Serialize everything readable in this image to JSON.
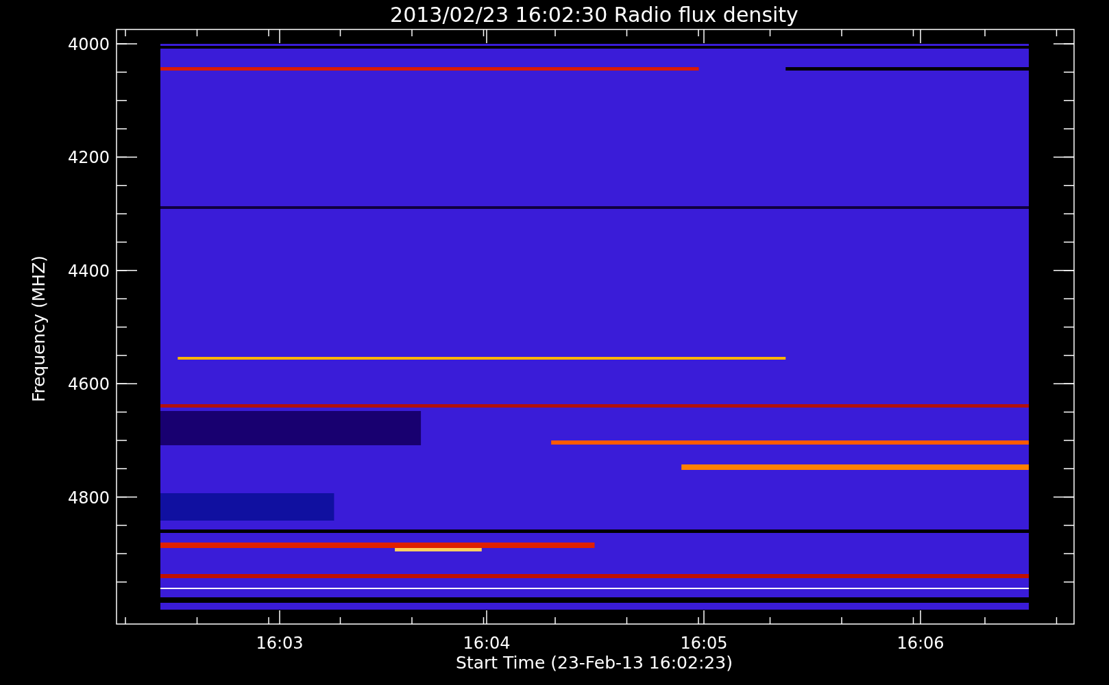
{
  "title": "2013/02/23 16:02:30 Radio flux density",
  "y_axis": {
    "label": "Frequency (MHZ)",
    "ticks": [
      "4000",
      "4200",
      "4400",
      "4600",
      "4800"
    ]
  },
  "x_axis": {
    "label": "Start Time (23-Feb-13 16:02:23)",
    "ticks": [
      "16:03",
      "16:04",
      "16:05",
      "16:06"
    ]
  }
}
